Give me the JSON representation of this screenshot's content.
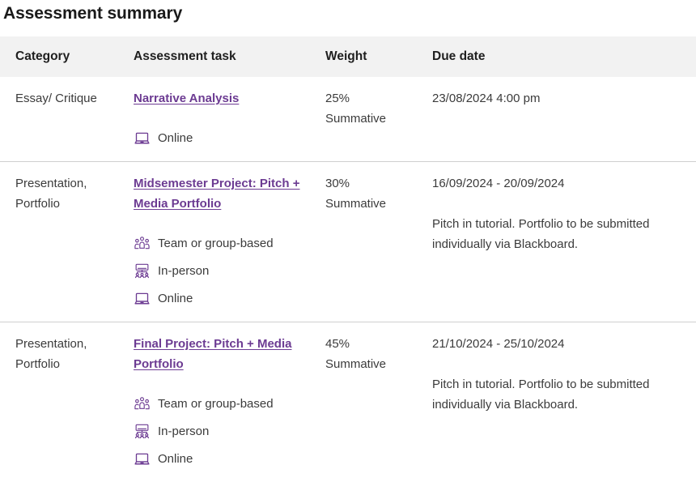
{
  "page": {
    "title": "Assessment summary"
  },
  "colors": {
    "link": "#6c3b92",
    "icon": "#6c3b92",
    "header_bg": "#f2f2f2",
    "text": "#3b3b3b",
    "divider": "#cfcfcf"
  },
  "table": {
    "columns": [
      {
        "key": "category",
        "label": "Category"
      },
      {
        "key": "task",
        "label": "Assessment task"
      },
      {
        "key": "weight",
        "label": "Weight"
      },
      {
        "key": "due",
        "label": "Due date"
      }
    ],
    "rows": [
      {
        "category": "Essay/ Critique",
        "task_link": "Narrative Analysis",
        "modes": [
          {
            "icon": "laptop-icon",
            "label": "Online"
          }
        ],
        "weight_percent": "25%",
        "weight_type": "Summative",
        "due_main": "23/08/2024 4:00 pm",
        "due_note": ""
      },
      {
        "category": "Presentation, Portfolio",
        "task_link": "Midsemester Project: Pitch + Media Portfolio",
        "modes": [
          {
            "icon": "group-people-icon",
            "label": "Team or group-based"
          },
          {
            "icon": "presentation-audience-icon",
            "label": "In-person"
          },
          {
            "icon": "laptop-icon",
            "label": "Online"
          }
        ],
        "weight_percent": "30%",
        "weight_type": "Summative",
        "due_main": "16/09/2024 - 20/09/2024",
        "due_note": "Pitch in tutorial. Portfolio to be submitted individually via Blackboard."
      },
      {
        "category": "Presentation, Portfolio",
        "task_link": "Final Project: Pitch + Media Portfolio",
        "modes": [
          {
            "icon": "group-people-icon",
            "label": "Team or group-based"
          },
          {
            "icon": "presentation-audience-icon",
            "label": "In-person"
          },
          {
            "icon": "laptop-icon",
            "label": "Online"
          }
        ],
        "weight_percent": "45%",
        "weight_type": "Summative",
        "due_main": "21/10/2024 - 25/10/2024",
        "due_note": "Pitch in tutorial. Portfolio to be submitted individually via Blackboard."
      }
    ]
  }
}
